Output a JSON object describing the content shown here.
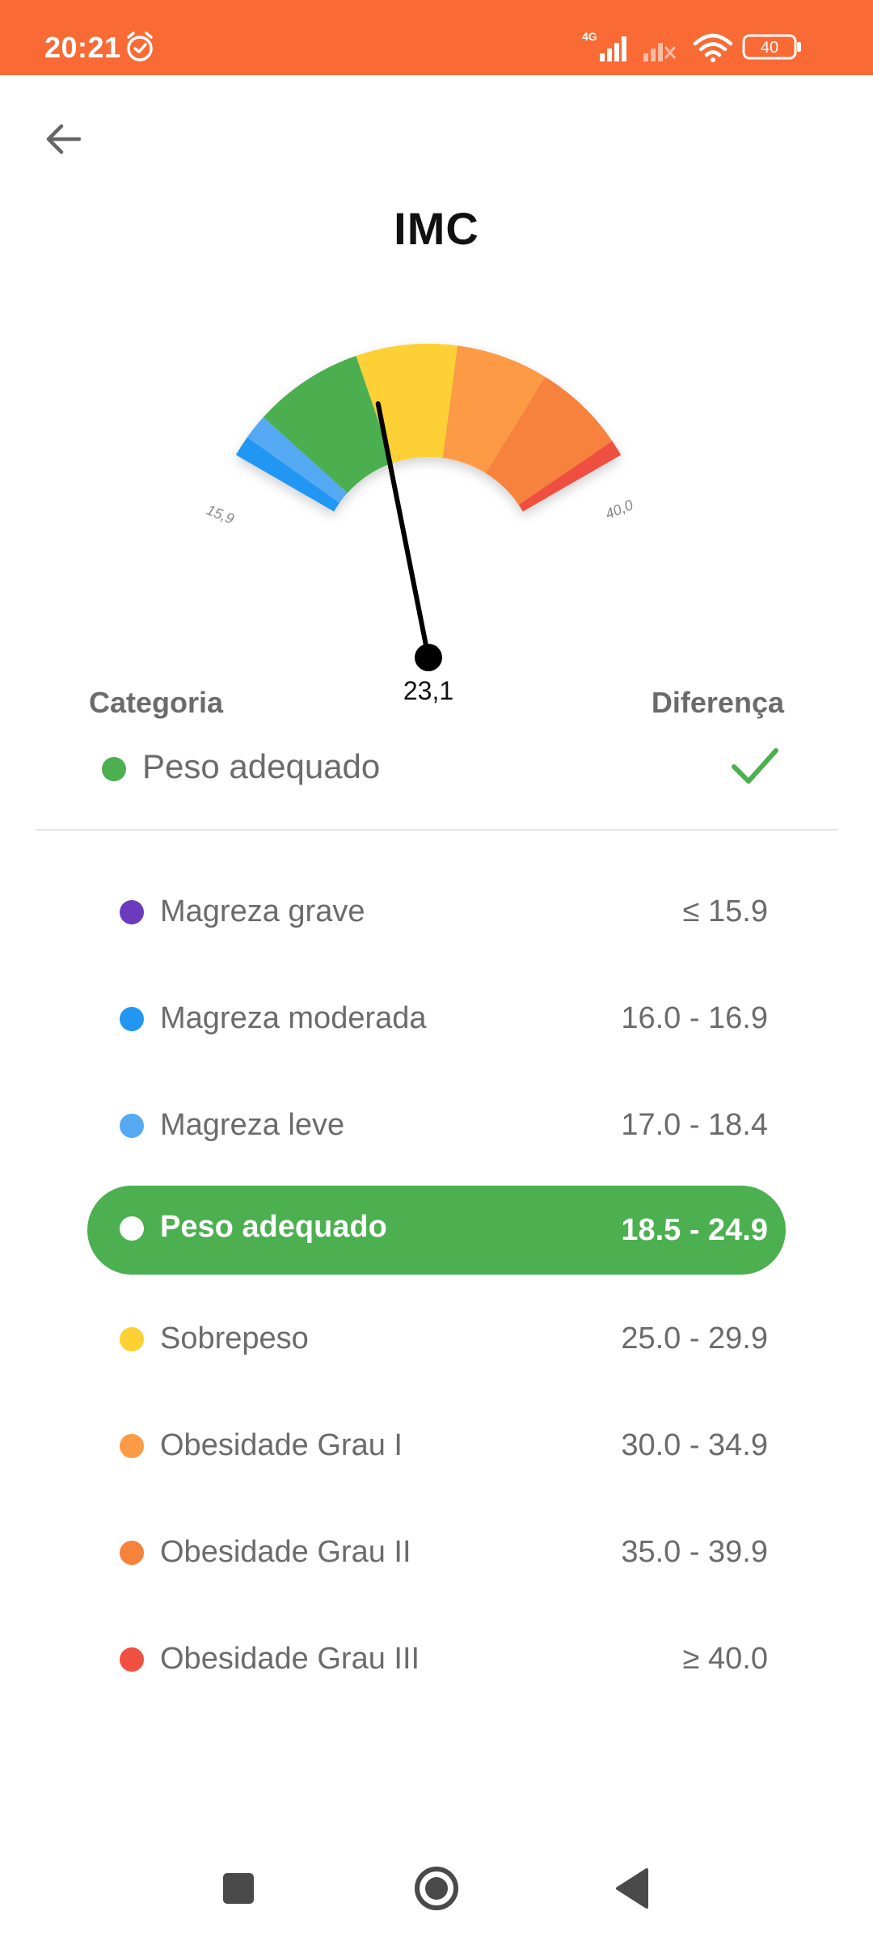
{
  "status_bar": {
    "time": "20:21",
    "network_label": "4G",
    "battery": "40",
    "icons": [
      "alarm-icon",
      "signal-icon",
      "signal-off-icon",
      "wifi-icon",
      "battery-icon"
    ],
    "color": "#f96a35"
  },
  "header": {
    "back_icon": "arrow-left-icon",
    "title": "IMC"
  },
  "gauge": {
    "min_label": "15,9",
    "max_label": "40,0",
    "min": 15.9,
    "max": 40.0,
    "value": 23.1,
    "value_label": "23,1",
    "segments": [
      {
        "name": "Magreza moderada",
        "color": "#2196f3"
      },
      {
        "name": "Magreza leve",
        "color": "#55a9f3"
      },
      {
        "name": "Peso adequado",
        "color": "#4caf50"
      },
      {
        "name": "Sobrepeso",
        "color": "#fdd034"
      },
      {
        "name": "Obesidade Grau I",
        "color": "#fd9a45"
      },
      {
        "name": "Obesidade Grau II",
        "color": "#f7823c"
      },
      {
        "name": "Obesidade Grau III",
        "color": "#ef5040"
      }
    ]
  },
  "summary": {
    "category_header": "Categoria",
    "difference_header": "Diferença",
    "current_category": "Peso adequado",
    "current_color": "#4caf50",
    "status_icon": "check-icon"
  },
  "ranges": [
    {
      "label": "Magreza grave",
      "value": "≤ 15.9",
      "color": "#6c3bbd"
    },
    {
      "label": "Magreza moderada",
      "value": "16.0 - 16.9",
      "color": "#2196f3"
    },
    {
      "label": "Magreza leve",
      "value": "17.0 - 18.4",
      "color": "#55a9f3"
    },
    {
      "label": "Peso adequado",
      "value": "18.5 - 24.9",
      "color": "#ffffff",
      "active": true,
      "highlight": "#4caf50"
    },
    {
      "label": "Sobrepeso",
      "value": "25.0 - 29.9",
      "color": "#fdd034"
    },
    {
      "label": "Obesidade Grau I",
      "value": "30.0 - 34.9",
      "color": "#fd9a45"
    },
    {
      "label": "Obesidade Grau II",
      "value": "35.0 - 39.9",
      "color": "#f7823c"
    },
    {
      "label": "Obesidade Grau III",
      "value": "≥ 40.0",
      "color": "#ef5040"
    }
  ],
  "nav_bar": {
    "icons": [
      "recents-square-icon",
      "home-circle-icon",
      "back-triangle-icon"
    ]
  }
}
